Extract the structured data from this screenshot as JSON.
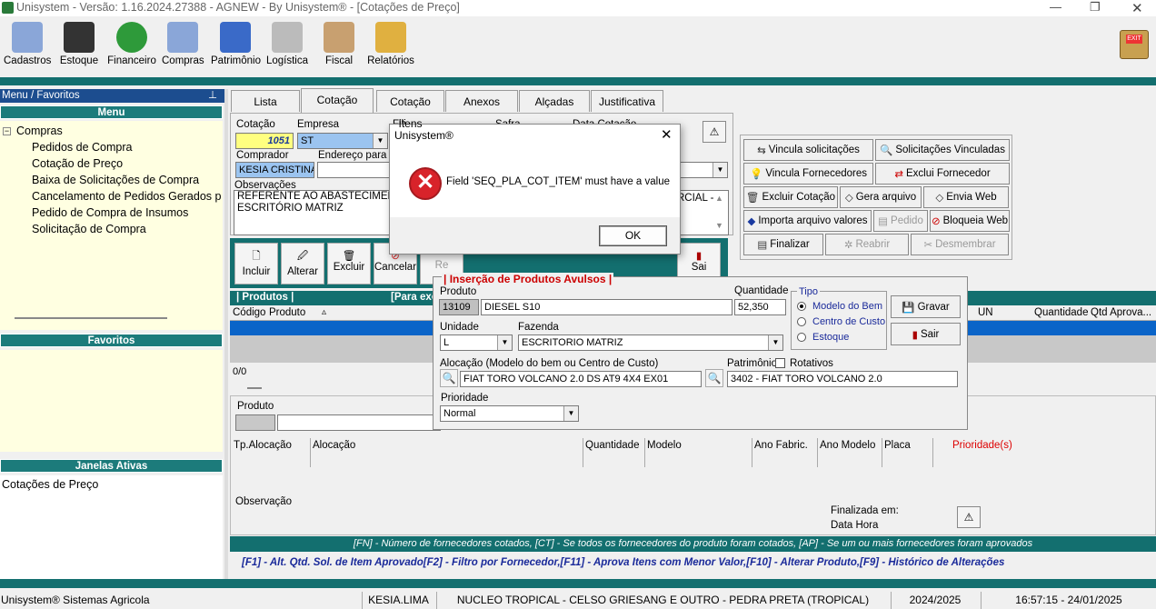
{
  "window": {
    "title": "Unisystem - Versão: 1.16.2024.27388 - AGNEW - By Unisystem® - [Cotações de Preço]"
  },
  "toolbar": {
    "items": [
      {
        "label": "Cadastros",
        "icon": "id-card-icon"
      },
      {
        "label": "Estoque",
        "icon": "barcode-icon"
      },
      {
        "label": "Financeiro",
        "icon": "dollar-icon"
      },
      {
        "label": "Compras",
        "icon": "pencil-icon"
      },
      {
        "label": "Patrimônio",
        "icon": "chair-icon"
      },
      {
        "label": "Logística",
        "icon": "truck-icon"
      },
      {
        "label": "Fiscal",
        "icon": "person-icon"
      },
      {
        "label": "Relatórios",
        "icon": "report-icon"
      }
    ]
  },
  "sidebar": {
    "header": "Menu / Favoritos",
    "menu_title": "Menu",
    "root": "Compras",
    "items": [
      "Pedidos de Compra",
      "Cotação de Preço",
      "Baixa de Solicitações de Compra",
      "Cancelamento de Pedidos Gerados p",
      "Pedido de Compra de Insumos",
      "Solicitação de Compra"
    ],
    "favorites_title": "Favoritos",
    "active_title": "Janelas Ativas",
    "active_items": [
      "Cotações de Preço"
    ]
  },
  "tabs": [
    "Lista",
    "Cotação",
    "Cotação Itens",
    "Anexos",
    "Alçadas",
    "Justificativa"
  ],
  "form": {
    "cotacao_label": "Cotação",
    "cotacao_value": "1051",
    "empresa_label": "Empresa",
    "empresa_value": "ST",
    "filial_label": "Fili",
    "safra_label": "Safra",
    "data_label": "Data Cotação",
    "comprador_label": "Comprador",
    "comprador_value": "KESIA CRISTINA",
    "endereco_label": "Endereço para E",
    "obs_label": "Observações",
    "obs_value_left": "REFERENTE AO ABASTECIMENT\nESCRITÓRIO MATRIZ",
    "obs_value_right": "RCIAL -"
  },
  "actions": {
    "incluir": "Incluir",
    "alterar": "Alterar",
    "excluir": "Excluir",
    "cancelar": "Cancelar",
    "re": "Re",
    "sai": "Sai"
  },
  "right_buttons": [
    {
      "label": "Vincula solicitações",
      "enabled": true
    },
    {
      "label": "Solicitações Vinculadas",
      "enabled": true
    },
    {
      "label": "Vincula Fornecedores",
      "enabled": true
    },
    {
      "label": "Exclui Fornecedor",
      "enabled": true
    },
    {
      "label": "Excluir Cotação",
      "enabled": true
    },
    {
      "label": "Gera arquivo",
      "enabled": true
    },
    {
      "label": "Envia Web",
      "enabled": true
    },
    {
      "label": "Importa arquivo valores",
      "enabled": true
    },
    {
      "label": "Pedido",
      "enabled": false
    },
    {
      "label": "Bloqueia Web",
      "enabled": true
    },
    {
      "label": "Finalizar",
      "enabled": true
    },
    {
      "label": "Reabrir",
      "enabled": false
    },
    {
      "label": "Desmembrar",
      "enabled": false
    }
  ],
  "products": {
    "header": "| Produtos |",
    "header2": "[Para exc",
    "col_codigo": "Código",
    "col_produto": "Produto",
    "col_un": "UN",
    "col_qtd": "Quantidade",
    "col_qtdaprov": "Qtd Aprova...",
    "count": "0/0"
  },
  "lower": {
    "produto_label": "Produto",
    "tp_alocacao": "Tp.Alocação",
    "alocacao": "Alocação",
    "quantidade": "Quantidade",
    "modelo": "Modelo",
    "ano_fabric": "Ano Fabric.",
    "ano_modelo": "Ano Modelo",
    "placa": "Placa",
    "prioridades": "Prioridade(s)",
    "observacao": "Observação",
    "finalizada": "Finalizada em:",
    "data_hora": "Data Hora"
  },
  "legend1": "[FN] - Número de fornecedores cotados,  [CT] - Se todos os fornecedores do produto foram cotados,  [AP] - Se um ou mais fornecedores foram aprovados",
  "legend2": "[F1] - Alt. Qtd. Sol. de Item Aprovado[F2] - Filtro por Fornecedor,[F11] - Aprova Itens com Menor Valor,[F10] - Alterar Produto,[F9] - Histórico de Alterações",
  "insert_panel": {
    "title": "| Inserção de Produtos Avulsos |",
    "produto_label": "Produto",
    "produto_code": "13109",
    "produto_name": "DIESEL S10",
    "quantidade_label": "Quantidade",
    "quantidade_value": "52,350",
    "tipo_label": "Tipo",
    "tipo_options": [
      "Modelo do Bem",
      "Centro de Custo",
      "Estoque"
    ],
    "tipo_selected": "Modelo do Bem",
    "gravar": "Gravar",
    "sair": "Sair",
    "unidade_label": "Unidade",
    "unidade_value": "L",
    "fazenda_label": "Fazenda",
    "fazenda_value": "ESCRITORIO MATRIZ",
    "alocacao_label": "Alocação (Modelo do bem ou Centro de Custo)",
    "alocacao_value": "FIAT TORO VOLCANO 2.0 DS AT9 4X4 EX01",
    "patrimonio_label": "Patrimônio",
    "rotativos_label": "Rotativos",
    "patrimonio_value": "3402 - FIAT TORO VOLCANO 2.0",
    "prioridade_label": "Prioridade",
    "prioridade_value": "Normal"
  },
  "dialog": {
    "title": "Unisystem®",
    "message": "Field 'SEQ_PLA_COT_ITEM' must have a value",
    "ok": "OK"
  },
  "statusbar": {
    "company": "Unisystem® Sistemas Agricola",
    "user": "KESIA.LIMA",
    "unit": "NUCLEO TROPICAL - CELSO GRIESANG E OUTRO - PEDRA PRETA (TROPICAL)",
    "safra": "2024/2025",
    "datetime": "16:57:15 - 24/01/2025"
  },
  "colors": {
    "teal": "#1c7b7b",
    "accent_blue": "#0a64c8",
    "selected_row": "#0a64c8",
    "legend_bg": "#1c7b7b"
  }
}
